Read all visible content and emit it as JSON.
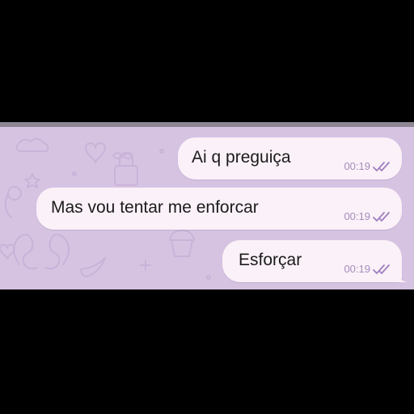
{
  "theme": {
    "background": "#d6c3e2",
    "bubble_color": "#fbf1f8",
    "time_color": "#a58dbd",
    "check_color": "#9f7fbf"
  },
  "messages": [
    {
      "text": "Ai q preguiça",
      "time": "00:19",
      "status_icon": "double-check-icon"
    },
    {
      "text": "Mas vou tentar me enforcar",
      "time": "00:19",
      "status_icon": "double-check-icon"
    },
    {
      "text": "Esforçar",
      "time": "00:19",
      "status_icon": "double-check-icon"
    }
  ]
}
